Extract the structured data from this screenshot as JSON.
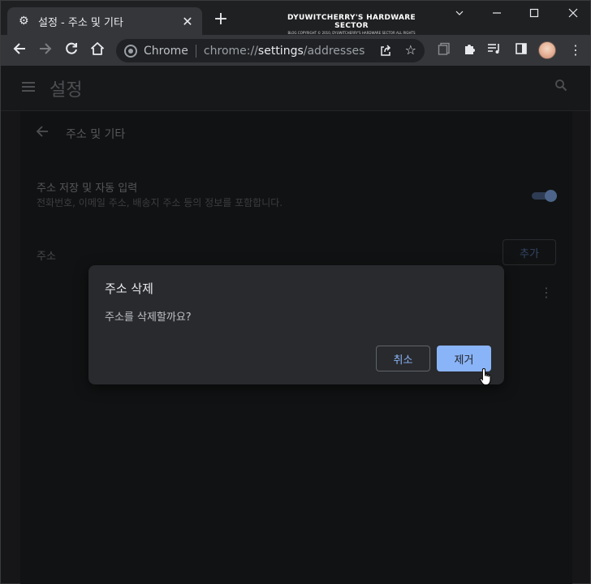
{
  "browser": {
    "tab_title": "설정 - 주소 및 기타",
    "omnibox": {
      "origin": "Chrome",
      "scheme": "chrome://",
      "host": "settings",
      "path": "/addresses"
    },
    "watermark_line1": "DYUWITCHERRY'S HARDWARE SECTOR",
    "watermark_line2": "BLOG COPYRIGHT © 2010, DYUWITCHERRY'S HARDWARE SECTOR ALL RIGHTS RESERVED."
  },
  "icons": {
    "settings": "gear-icon",
    "close_tab": "close-icon",
    "new_tab": "plus-icon",
    "back": "arrow-left-icon",
    "forward": "arrow-right-icon",
    "reload": "reload-icon",
    "home": "home-icon",
    "share": "share-icon",
    "bookmark": "star-icon",
    "tab_search": "tab-search-icon",
    "extensions": "puzzle-icon",
    "media": "media-queue-icon",
    "side_panel": "side-panel-icon",
    "menu": "kebab-icon",
    "hamburger": "hamburger-icon",
    "search": "search-icon"
  },
  "settings": {
    "header_title": "설정",
    "subpage_title": "주소 및 기타",
    "save_fill_title": "주소 저장 및 자동 입력",
    "save_fill_desc": "전화번호, 이메일 주소, 배송지 주소 등의 정보를 포함합니다.",
    "save_fill_enabled": true,
    "addresses_label": "주소",
    "add_label": "추가"
  },
  "dialog": {
    "title": "주소 삭제",
    "body": "주소를 삭제할까요?",
    "cancel_label": "취소",
    "remove_label": "제거"
  },
  "colors": {
    "accent": "#8ab4f8",
    "dialog_bg": "#292a2d",
    "toolbar_bg": "#35363a"
  }
}
